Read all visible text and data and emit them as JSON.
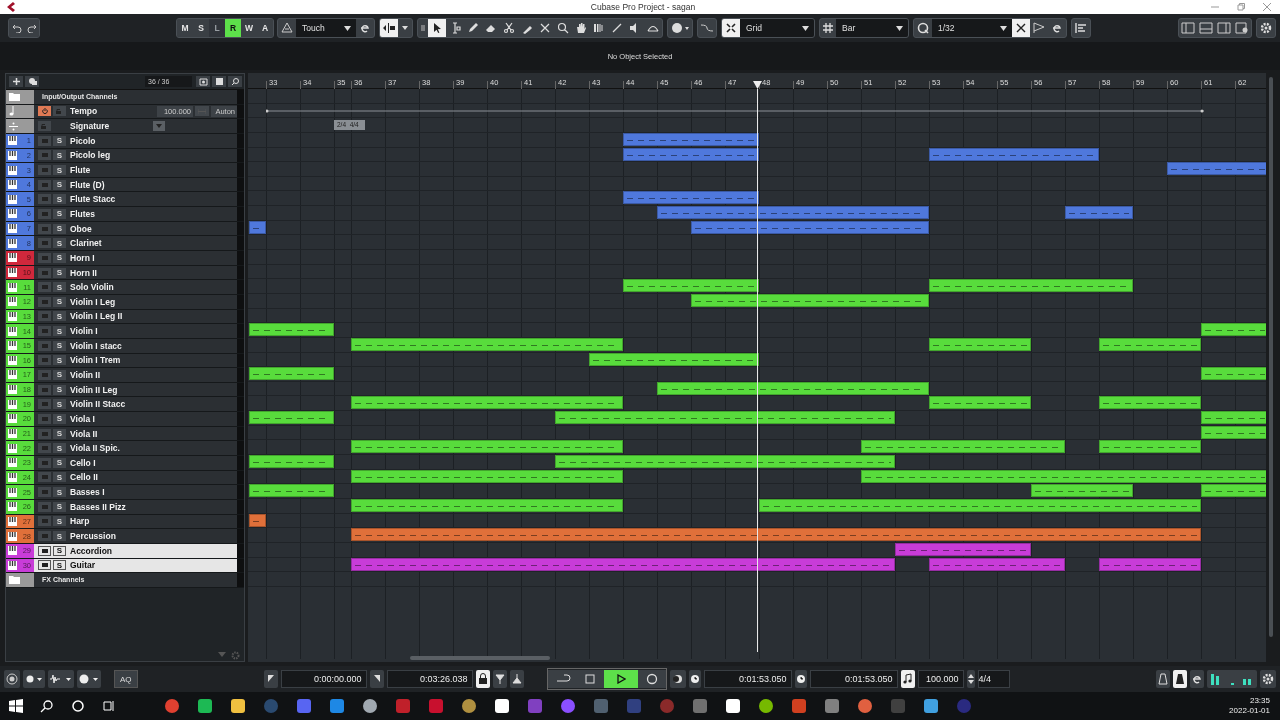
{
  "window": {
    "title": "Cubase Pro Project - sagan"
  },
  "toolbar": {
    "automation_buttons": [
      {
        "label": "M",
        "on": false,
        "disabled": false
      },
      {
        "label": "S",
        "on": false,
        "disabled": false
      },
      {
        "label": "L",
        "on": false,
        "disabled": true
      },
      {
        "label": "R",
        "on": true,
        "disabled": false
      },
      {
        "label": "W",
        "on": false,
        "disabled": false
      },
      {
        "label": "A",
        "on": false,
        "disabled": false
      }
    ],
    "automation_mode": "Touch",
    "snap_type": "Grid",
    "grid_type": "Bar",
    "quantize": "1/32"
  },
  "info_line": {
    "text": "No Object Selected"
  },
  "track_list": {
    "count": "36 / 36"
  },
  "tracks": [
    {
      "kind": "folder",
      "name": "Input/Output Channels"
    },
    {
      "kind": "tempo",
      "name": "Tempo",
      "on": true,
      "value": "100.000",
      "mode": "Auton"
    },
    {
      "kind": "signature",
      "name": "Signature"
    },
    {
      "kind": "instrument",
      "number": "1",
      "name": "Picolo",
      "solo": "S",
      "color": "#4f78dc",
      "selected": false
    },
    {
      "kind": "instrument",
      "number": "2",
      "name": "Picolo leg",
      "solo": "S",
      "color": "#4f78dc",
      "selected": false
    },
    {
      "kind": "instrument",
      "number": "3",
      "name": "Flute",
      "solo": "S",
      "color": "#4f78dc",
      "selected": false
    },
    {
      "kind": "instrument",
      "number": "4",
      "name": "Flute (D)",
      "solo": "S",
      "color": "#4f78dc",
      "selected": false
    },
    {
      "kind": "instrument",
      "number": "5",
      "name": "Flute Stacc",
      "solo": "S",
      "color": "#4f78dc",
      "selected": false
    },
    {
      "kind": "instrument",
      "number": "6",
      "name": "Flutes",
      "solo": "S",
      "color": "#4f78dc",
      "selected": false
    },
    {
      "kind": "instrument",
      "number": "7",
      "name": "Oboe",
      "solo": "S",
      "color": "#4f78dc",
      "selected": false
    },
    {
      "kind": "instrument",
      "number": "8",
      "name": "Clarinet",
      "solo": "S",
      "color": "#4f78dc",
      "selected": false
    },
    {
      "kind": "instrument",
      "number": "9",
      "name": "Horn I",
      "solo": "S",
      "color": "#d0283c",
      "selected": false
    },
    {
      "kind": "instrument",
      "number": "10",
      "name": "Horn II",
      "solo": "S",
      "color": "#d0283c",
      "selected": false
    },
    {
      "kind": "instrument",
      "number": "11",
      "name": "Solo Violin",
      "solo": "S",
      "color": "#58dc3c",
      "selected": false
    },
    {
      "kind": "instrument",
      "number": "12",
      "name": "Violin I Leg",
      "solo": "S",
      "color": "#58dc3c",
      "selected": false
    },
    {
      "kind": "instrument",
      "number": "13",
      "name": "Violin I Leg II",
      "solo": "S",
      "color": "#58dc3c",
      "selected": false
    },
    {
      "kind": "instrument",
      "number": "14",
      "name": "Violin I",
      "solo": "S",
      "color": "#58dc3c",
      "selected": false
    },
    {
      "kind": "instrument",
      "number": "15",
      "name": "Violin I stacc",
      "solo": "S",
      "color": "#58dc3c",
      "selected": false
    },
    {
      "kind": "instrument",
      "number": "16",
      "name": "Violin I Trem",
      "solo": "S",
      "color": "#58dc3c",
      "selected": false
    },
    {
      "kind": "instrument",
      "number": "17",
      "name": "Violin II",
      "solo": "S",
      "color": "#58dc3c",
      "selected": false
    },
    {
      "kind": "instrument",
      "number": "18",
      "name": "Violin II Leg",
      "solo": "S",
      "color": "#58dc3c",
      "selected": false
    },
    {
      "kind": "instrument",
      "number": "19",
      "name": "Violin II Stacc",
      "solo": "S",
      "color": "#58dc3c",
      "selected": false
    },
    {
      "kind": "instrument",
      "number": "20",
      "name": "Viola I",
      "solo": "S",
      "color": "#58dc3c",
      "selected": false
    },
    {
      "kind": "instrument",
      "number": "21",
      "name": "Viola II",
      "solo": "S",
      "color": "#58dc3c",
      "selected": false
    },
    {
      "kind": "instrument",
      "number": "22",
      "name": "Viola II Spic.",
      "solo": "S",
      "color": "#58dc3c",
      "selected": false
    },
    {
      "kind": "instrument",
      "number": "23",
      "name": "Cello I",
      "solo": "S",
      "color": "#58dc3c",
      "selected": false
    },
    {
      "kind": "instrument",
      "number": "24",
      "name": "Cello II",
      "solo": "S",
      "color": "#58dc3c",
      "selected": false
    },
    {
      "kind": "instrument",
      "number": "25",
      "name": "Basses I",
      "solo": "S",
      "color": "#58dc3c",
      "selected": false
    },
    {
      "kind": "instrument",
      "number": "26",
      "name": "Basses II Pizz",
      "solo": "S",
      "color": "#58dc3c",
      "selected": false
    },
    {
      "kind": "instrument",
      "number": "27",
      "name": "Harp",
      "solo": "S",
      "color": "#e0703a",
      "selected": false
    },
    {
      "kind": "instrument",
      "number": "28",
      "name": "Percussion",
      "solo": "S",
      "color": "#e0703a",
      "selected": false
    },
    {
      "kind": "instrument",
      "number": "29",
      "name": "Accordion",
      "solo": "S",
      "color": "#c83cd8",
      "selected": true
    },
    {
      "kind": "instrument",
      "number": "30",
      "name": "Guitar",
      "solo": "S",
      "color": "#c83cd8",
      "selected": true
    },
    {
      "kind": "folder",
      "name": "FX Channels"
    }
  ],
  "ruler": {
    "bars": [
      "33",
      "34",
      "35",
      "36",
      "37",
      "38",
      "39",
      "40",
      "41",
      "42",
      "43",
      "44",
      "45",
      "46",
      "47",
      "48",
      "49",
      "50",
      "51",
      "52",
      "53",
      "54",
      "55",
      "56",
      "57",
      "58",
      "59",
      "60",
      "61",
      "62"
    ],
    "signature_marker": "2/4  4/4"
  },
  "transport": {
    "aq": "AQ",
    "left_locator": "0:00:00.000",
    "right_locator": "0:03:26.038",
    "playing": true,
    "primary_time": "0:01:53.050",
    "secondary_time": "0:01:53.050",
    "tempo": "100.000",
    "signature": "4/4"
  },
  "taskbar": {
    "time": "23:35",
    "date": "2022-01-01"
  }
}
